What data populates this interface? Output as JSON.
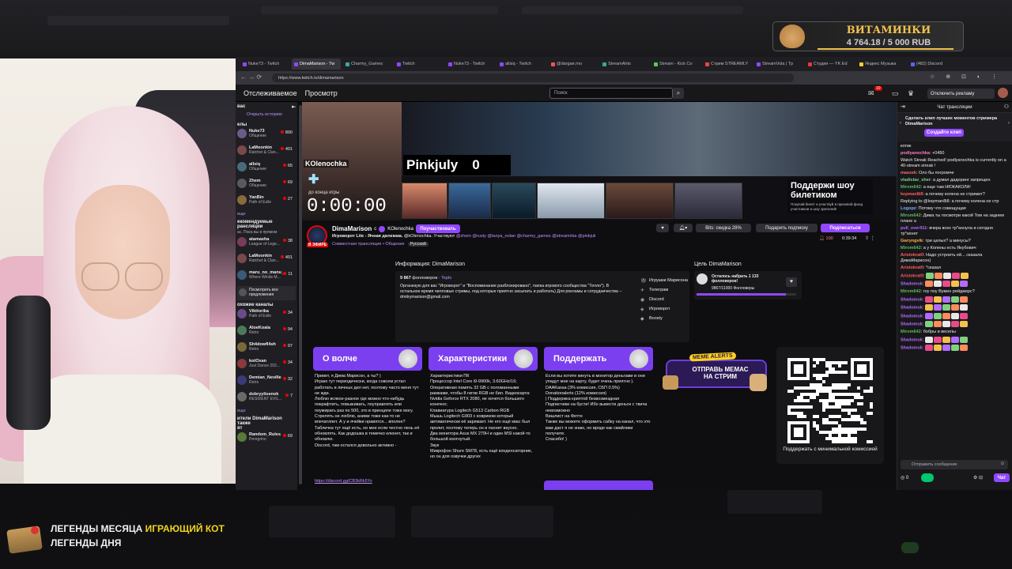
{
  "overlay": {
    "goal_title": "ВИТАМИНКИ",
    "goal_amount": "4 764.18 / 5 000 RUB",
    "goal_fill": 0.953,
    "legend_month_label": "ЛЕГЕНДЫ МЕСЯЦА",
    "legend_month_value": "ИГРАЮЩИЙ КОТ",
    "legend_day_label": "ЛЕГЕНДЫ ДНЯ"
  },
  "browser": {
    "tabs": [
      "Nuke73 - Twitch",
      "DimaMarison - Tw",
      "Charmy_Games",
      "Twitch",
      "Nuke73 - Twitch",
      "allsiq - Twitch",
      "@dargae.mo",
      "StreamAlrts",
      "Stream - Kick Co",
      "Стрим STREAMLY",
      "StreamVola | Tp",
      "Студия — YK Ed",
      "Яндекс Музыка",
      "(482) Discord"
    ],
    "active_tab": 1,
    "url": "https://www.twitch.tv/dimamarison"
  },
  "twitch": {
    "nav_following": "Отслеживаемое",
    "nav_browse": "Просмотр",
    "search_placeholder": "Поиск",
    "notif_count": "10",
    "noads": "Отключить рекламу",
    "sidebar": {
      "header": "вас",
      "history": "Открыть историю",
      "section_channels": "елы",
      "items": [
        {
          "name": "Nuke73",
          "cat": "Общение",
          "count": "890",
          "color": "#6b5b8a"
        },
        {
          "name": "LaMoonkin",
          "cat": "Ratchet & Clan...",
          "count": "401",
          "color": "#7a4a4a"
        },
        {
          "name": "allsiq",
          "cat": "Общение",
          "count": "65",
          "color": "#4a6a7a"
        },
        {
          "name": "Zhem",
          "cat": "Общение",
          "count": "69",
          "color": "#5a5a5a"
        },
        {
          "name": "YanBin",
          "cat": "Path of Exile",
          "count": "27",
          "color": "#8a6a3a"
        }
      ],
      "more1": "еще",
      "section_rec": "екомендуемые\nрансляции",
      "rec_note": "ас. Пока вы в прямом",
      "items2": [
        {
          "name": "atamasha",
          "cat": "League of Lege...",
          "count": "38",
          "color": "#7a3a5a"
        },
        {
          "name": "LaMoonkin",
          "cat": "Ratchet & Clan...",
          "count": "401",
          "color": "#7a4a4a"
        },
        {
          "name": "maru_no_manu_",
          "cat": "Where Winds M...",
          "count": "11",
          "color": "#3a5a7a"
        }
      ],
      "see_all": "Посмотреть все предложения",
      "section_similar": "охожие каналы",
      "items3": [
        {
          "name": "Vikttorika",
          "cat": "Path of Exile",
          "count": "34",
          "color": "#6a4a8a"
        },
        {
          "name": "AloeKoala",
          "cat": "Retro",
          "count": "94",
          "color": "#4a7a5a"
        },
        {
          "name": "Sh4dowfl4sh",
          "cat": "Retro",
          "count": "97",
          "color": "#7a6a3a"
        },
        {
          "name": "kotOxan",
          "cat": "Just Dance 202...",
          "count": "34",
          "color": "#8a3a3a"
        },
        {
          "name": "Demian_Neville",
          "cat": "Retro",
          "count": "32",
          "color": "#3a3a7a"
        },
        {
          "name": "dobryylisenok",
          "cat": "RESIDENT EVIL...",
          "count": "7",
          "color": "#6a6a6a"
        }
      ],
      "more3": "еще",
      "section_viewers": "ители DimaMarison также",
      "section_viewers2": "ят",
      "items4": [
        {
          "name": "Random_Rules",
          "cat": "Peregrino",
          "count": "69",
          "color": "#5a7a3a"
        }
      ]
    },
    "player": {
      "nick1": "KOlenochka",
      "nick2": "Pinkjuly",
      "score": "0",
      "till_label": "до конца игры",
      "timer": "0:00:00",
      "support_title": "Поддержи шоу билетиком",
      "support_sub": "Покупай билет и участвуй в призовой фонд участников и шоу зрителей!"
    },
    "info": {
      "channel": "DimaMarison",
      "with": "с",
      "partner": "KOlenochka",
      "follow": "Поучаствовать",
      "title": "Игроворот Lite - Ячная дилемма.",
      "title_with": "@kOlenochka. Участвуют",
      "mentions": "@zhem @rusty @tanya_nolan @charmy_games @streamirka @pinkjuli",
      "live": "В ЭФИРЕ",
      "coop": "Совместная трансляция • Общение",
      "lang": "Русский",
      "bits": "Bits: скидка 28%",
      "gift": "Подарить подписку",
      "subscribe": "Подписаться",
      "viewers": "100",
      "uptime": "0:39:34"
    },
    "about": {
      "header": "Информация: DimaMarison",
      "followers": "9 867",
      "followers_label": "фолловеров",
      "team": "Teplo",
      "desc": "Организую для вас \"Игроворот\" и \"Воспоминание разблокировано\", папка игрового сообщества \"Тепло\"). В остальное время чилловые стримы, под которые приятно засыпать и работать) Для рекламы и сотрудничества – dmitrymarison@gmail.com",
      "links": [
        "Игрушки Марисона",
        "Телеграм",
        "Discord",
        "Игроворот",
        "Boosty"
      ]
    },
    "goal": {
      "header": "Цель DimaMarison",
      "remain": "Осталось набрать 1 133 фолловеров!",
      "progress": "9867/11000 Фолловеры",
      "fill": 0.897
    },
    "panels": [
      {
        "title": "О волче",
        "color": "#7b3ff0",
        "text": "Привет, я Дима Марисон, а ты? )\nИграю тут периодически, когда совсем устал работать и личных дел нет, поэтому часто меня тут не жди.\nЛюблю всякое-разное где можно что-нибудь покрафтить, повыживать, поуправлять или поумирать раз по 500, это в принципе тоже могу. Стрелять не люблю, аниме тоже как-то не впечатляет. А у и ячейки нравятся... вполне?\nТабличка тут ещё есть, но мне если честно лень её обновлять. Как додошка в темечко клюнет, так и обновлю.\nDiscord, там остался довольно активно -",
        "link_label": "Табличка",
        "discord": "https://discord.gg/CB3kRk5Yv"
      },
      {
        "title": "Характеристики",
        "color": "#7b3ff0",
        "text": "Характеристики ПК\nПроцессор Intel Core i9-9900k, 3.60GHz/16; Оперативная память 32 GB с поломанными рамками, чтобы 8 гигов RGB не бил. Видеокарта: Nvidia Geforce RTX 2080, не хочется большего конечно;\nКлавиатура Logitech G513 Carbon RGB\nМышь Logitech G903 с ковриком который автоматически её заряжает. Не его ещё квас был пролит, поэтому теперь он и пахнет вкусно.\nДва монитора Asus MX 279H и один MSI какой-то большой изогнутый.\nЗвук\nМикрофон Shure SM78, есть ещё конденсаторник, но он для озвучки других"
      },
      {
        "title": "Поддержать",
        "color": "#7b3ff0",
        "text": "Если вы хотите кинуть в монитор деньгами и они упадут мне на карту, будет очень приятно ).\nDAAKassa (3% комиссия, СБП 0.5%)\nDonationalerts (12% комиссия)\n| Поддержка криптой безвозмездная\nПодписчики на бусти! Ибо вывести деньги с твича невозможно\nВишлист на Фетте\nТакже вы можете оформить сабку на канал, что это вам даст я не знаю, но вроде как смайлики получите.\nСпасибо! )"
      }
    ],
    "meme": {
      "top": "MEME ALERTS",
      "line1": "ОТПРАВЬ МЕМАС",
      "line2": "НА СТРИМ"
    },
    "qr_caption": "Поддержать с минимальной комиссией",
    "chat": {
      "header": "Чат трансляции",
      "clip_text": "Сделать клип лучших моментов стримера DimaMarison",
      "clip_btn": "Создайте клип",
      "input_placeholder": "Отправить сообщение",
      "send": "Чат",
      "points": "0",
      "messages": [
        {
          "user": "",
          "color": "#efeff1",
          "text": "котик"
        },
        {
          "user": "podlyanochka",
          "color": "#ff7fbf",
          "text": "+0450"
        },
        {
          "user": "",
          "color": "#efeff1",
          "text": "Watch Streak Reached! podlyanochka is currently on a 40-stream streak !"
        },
        {
          "user": "maezek",
          "color": "#ff6b6b",
          "text": "Оло бы погромче"
        },
        {
          "user": "vladislav_sher",
          "color": "#7fd17f",
          "text": "а думал дадоринг запрещен"
        },
        {
          "user": "Mirom642",
          "color": "#5cb85c",
          "text": "а еще там НЮКАКОЛА!"
        },
        {
          "user": "kepman8i8",
          "color": "#ff5c5c",
          "text": "а почему колена не стримит?"
        },
        {
          "user": "",
          "color": "#adadb8",
          "text": "Replying to @kepman8i8: а почему колена не стр"
        },
        {
          "user": "Logopz",
          "color": "#7fb0ff",
          "text": "Потому что совещущая"
        },
        {
          "user": "Mirom642",
          "color": "#5cb85c",
          "text": "Дима ты посмотри какой Том на заднем плане а"
        },
        {
          "user": "pull_over911",
          "color": "#b36bff",
          "text": "вчера всех тр*ахнула и сегодня тр*ахнет"
        },
        {
          "user": "Gwryngvik",
          "color": "#ffb347",
          "text": "три целых? а минусы?"
        },
        {
          "user": "Mirom642",
          "color": "#5cb85c",
          "text": "а у Колены есть Якубович"
        },
        {
          "user": "Aristokrat0",
          "color": "#ff5c5c",
          "text": "Надо устроить ей... сказала ДимаМарисон)"
        },
        {
          "user": "Aristokrat0",
          "color": "#ff5c5c",
          "text": "*сказал"
        },
        {
          "user": "Aristokrat0",
          "color": "#ff5c5c",
          "text": ""
        },
        {
          "user": "Shadomsk",
          "color": "#b36bff",
          "text": ""
        },
        {
          "user": "Mirom642",
          "color": "#5cb85c",
          "text": "гоу поу Вумен рейджерс?"
        },
        {
          "user": "Shadomsk",
          "color": "#b36bff",
          "text": ""
        },
        {
          "user": "Shadomsk",
          "color": "#b36bff",
          "text": ""
        },
        {
          "user": "Shadomsk",
          "color": "#b36bff",
          "text": ""
        },
        {
          "user": "Shadomsk",
          "color": "#b36bff",
          "text": ""
        },
        {
          "user": "Mirom642",
          "color": "#5cb85c",
          "text": "бобры и веселы"
        },
        {
          "user": "Shadomsk",
          "color": "#b36bff",
          "text": ""
        },
        {
          "user": "Shadomsk",
          "color": "#b36bff",
          "text": ""
        }
      ]
    }
  }
}
